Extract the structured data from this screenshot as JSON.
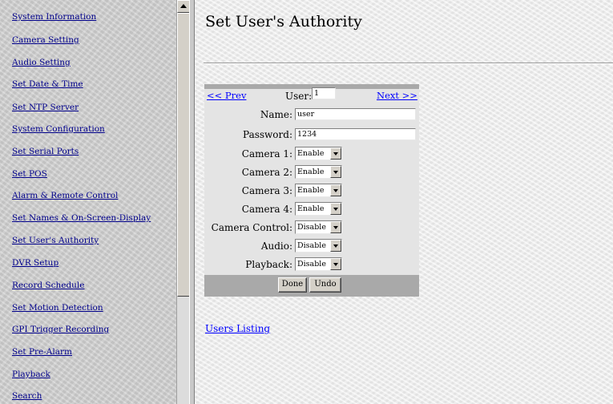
{
  "nav": {
    "items": [
      "System Information",
      "Camera Setting",
      "Audio Setting",
      "Set Date & Time",
      "Set NTP Server",
      "System Configuration",
      "Set Serial Ports",
      "Set POS",
      "Alarm & Remote Control",
      "Set Names & On-Screen-Display",
      "Set User's Authority",
      "DVR Setup",
      "Record Schedule",
      "Set Motion Detection",
      "GPI Trigger Recording",
      "Set Pre-Alarm",
      "Playback",
      "Search"
    ]
  },
  "page": {
    "title": "Set User's Authority",
    "prev_label": "<< Prev",
    "next_label": "Next >>",
    "user_label": "User:",
    "user_value": "1",
    "name_label": "Name:",
    "name_value": "user",
    "password_label": "Password:",
    "password_value": "1234",
    "permissions": [
      {
        "label": "Camera 1:",
        "value": "Enable"
      },
      {
        "label": "Camera 2:",
        "value": "Enable"
      },
      {
        "label": "Camera 3:",
        "value": "Enable"
      },
      {
        "label": "Camera 4:",
        "value": "Enable"
      },
      {
        "label": "Camera Control:",
        "value": "Disable"
      },
      {
        "label": "Audio:",
        "value": "Disable"
      },
      {
        "label": "Playback:",
        "value": "Disable"
      }
    ],
    "done_label": "Done",
    "undo_label": "Undo",
    "users_listing_label": "Users Listing"
  }
}
